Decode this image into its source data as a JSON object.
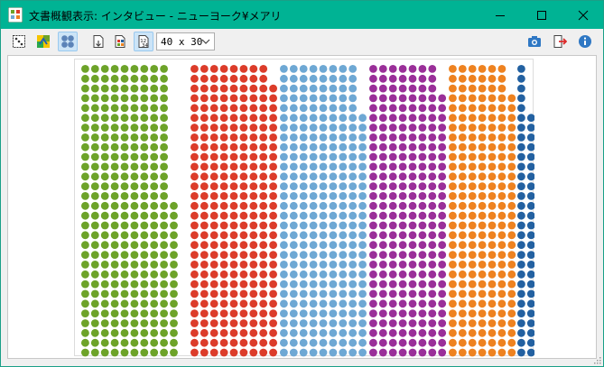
{
  "window": {
    "title": "文書概観表示: インタビュー - ニューヨーク¥メアリ"
  },
  "titlebar_buttons": [
    "minimize-icon",
    "maximize-icon",
    "close-icon"
  ],
  "toolbar": {
    "buttons": [
      "dice-icon",
      "refresh-colors-icon",
      "bubbles-view-icon",
      "export-document-icon",
      "color-code-icon",
      "segment-numbers-icon"
    ],
    "zoom": {
      "selected": "40 x 30"
    },
    "right_buttons": [
      "snapshot-camera-icon",
      "exit-icon",
      "info-icon"
    ]
  },
  "colors": {
    "accent": "#00b394",
    "green": "#6da329",
    "red": "#dc3c2a",
    "lightblue": "#6ea8d4",
    "purple": "#9a2f99",
    "orange": "#ee8220",
    "darkblue": "#2361a1"
  },
  "chart_data": {
    "type": "dot-matrix",
    "rows": 30,
    "groups": [
      {
        "color": "green",
        "columns": 10,
        "last_column_dots": 16
      },
      {
        "color": "red",
        "columns": 9,
        "last_column_dots": 28
      },
      {
        "color": "lightblue",
        "columns": 9,
        "last_column_dots": 25
      },
      {
        "color": "purple",
        "columns": 8,
        "last_column_dots": 27
      },
      {
        "color": "orange",
        "columns": 7,
        "last_column_dots": 27
      },
      {
        "color": "darkblue",
        "columns": 2,
        "last_column_dots": 25
      }
    ]
  }
}
